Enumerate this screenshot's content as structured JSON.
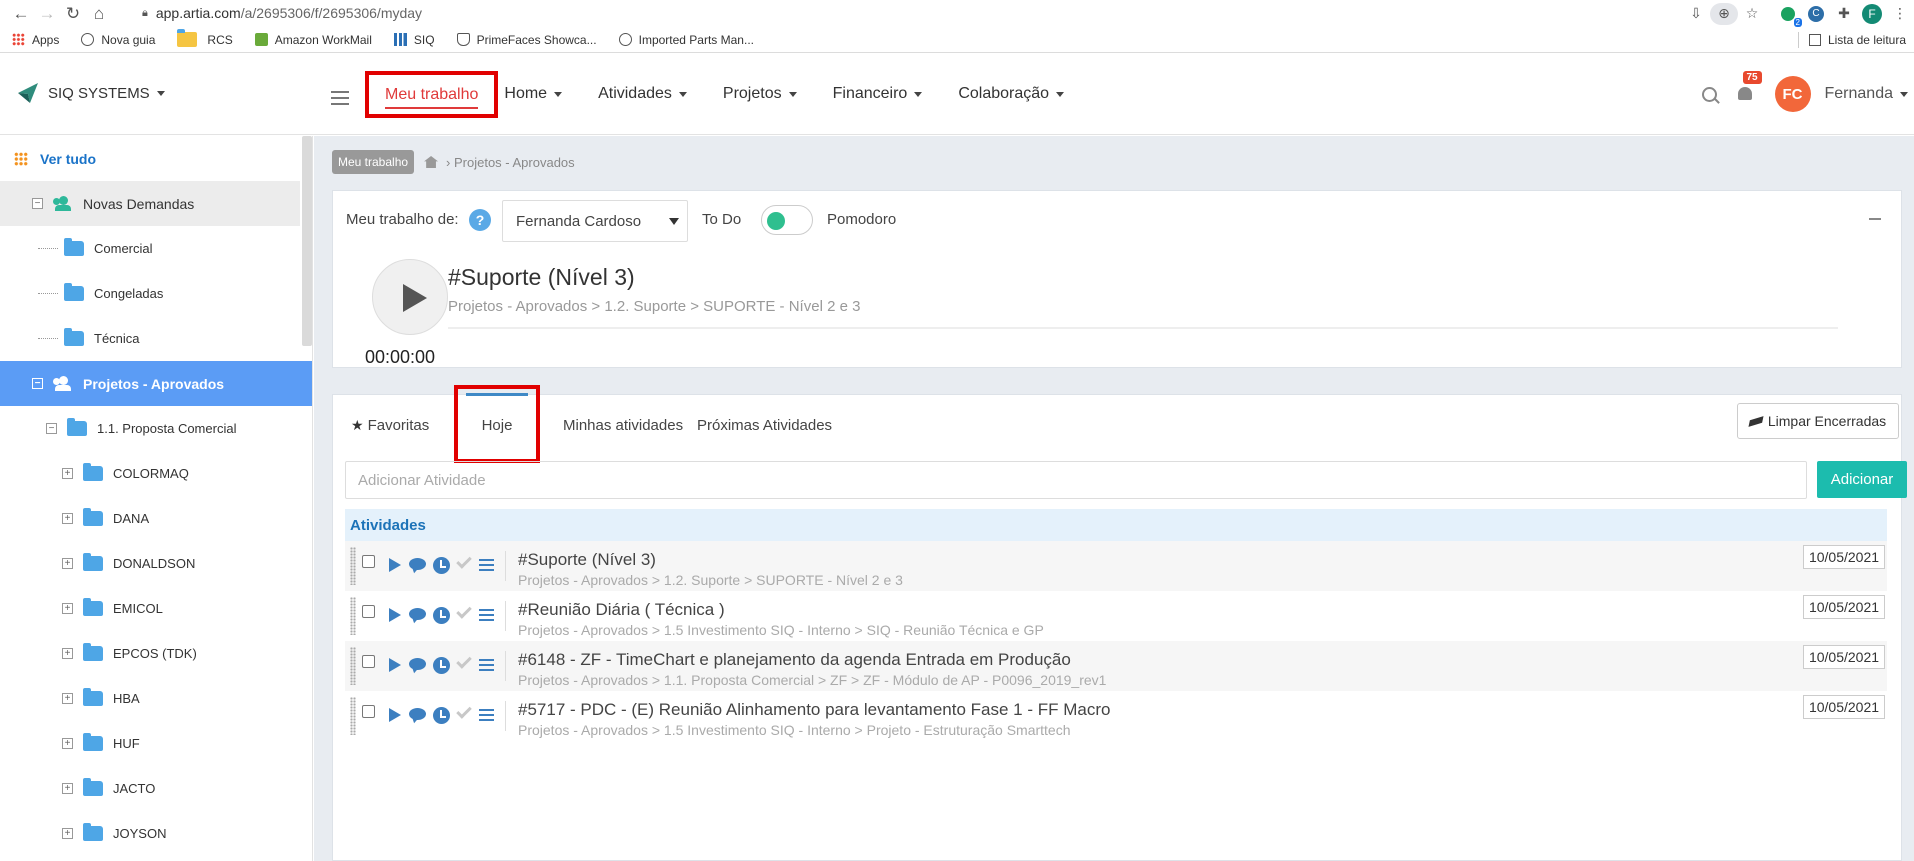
{
  "browser": {
    "url_host": "app.artia.com",
    "url_path": "/a/2695306/f/2695306/myday",
    "ext_badge": "2",
    "profile_initial": "F",
    "bookmarks": [
      "Apps",
      "Nova guia",
      "RCS",
      "Amazon WorkMail",
      "SIQ",
      "PrimeFaces Showca...",
      "Imported Parts Man..."
    ],
    "reading_list": "Lista de leitura"
  },
  "header": {
    "brand": "SIQ SYSTEMS",
    "nav": [
      "Meu trabalho",
      "Home",
      "Atividades",
      "Projetos",
      "Financeiro",
      "Colaboração"
    ],
    "notification_count": "75",
    "avatar_initials": "FC",
    "user_name": "Fernanda"
  },
  "sidebar": {
    "ver_tudo": "Ver tudo",
    "items": [
      "Novas Demandas",
      "Comercial",
      "Congeladas",
      "Técnica",
      "Projetos - Aprovados",
      "1.1. Proposta Comercial",
      "COLORMAQ",
      "DANA",
      "DONALDSON",
      "EMICOL",
      "EPCOS (TDK)",
      "HBA",
      "HUF",
      "JACTO",
      "JOYSON"
    ]
  },
  "breadcrumb": {
    "button": "Meu trabalho",
    "path": "› Projetos - Aprovados"
  },
  "timer_panel": {
    "label": "Meu trabalho de:",
    "help": "?",
    "user_selected": "Fernanda Cardoso",
    "todo": "To Do",
    "pomodoro": "Pomodoro",
    "time": "00:00:00",
    "current_title": "#Suporte (Nível 3)",
    "current_path": "Projetos - Aprovados > 1.2. Suporte > SUPORTE - Nível 2 e 3"
  },
  "activities_panel": {
    "tabs": [
      "Favoritas",
      "Hoje",
      "Minhas atividades",
      "Próximas Atividades"
    ],
    "clear_button": "Limpar Encerradas",
    "add_placeholder": "Adicionar Atividade",
    "add_button": "Adicionar",
    "section_title": "Atividades",
    "rows": [
      {
        "title": "#Suporte (Nível 3)",
        "path": "Projetos - Aprovados > 1.2. Suporte > SUPORTE - Nível 2 e 3",
        "date": "10/05/2021"
      },
      {
        "title": "#Reunião Diária ( Técnica )",
        "path": "Projetos - Aprovados > 1.5 Investimento SIQ - Interno > SIQ - Reunião Técnica e GP",
        "date": "10/05/2021"
      },
      {
        "title": "#6148 - ZF - TimeChart e planejamento da agenda Entrada em Produção",
        "path": "Projetos - Aprovados > 1.1. Proposta Comercial > ZF > ZF - Módulo de AP - P0096_2019_rev1",
        "date": "10/05/2021"
      },
      {
        "title": "#5717 - PDC - (E) Reunião Alinhamento para levantamento Fase 1 - FF Macro",
        "path": "Projetos - Aprovados > 1.5 Investimento SIQ - Interno > Projeto - Estruturação Smarttech",
        "date": "10/05/2021"
      }
    ]
  }
}
